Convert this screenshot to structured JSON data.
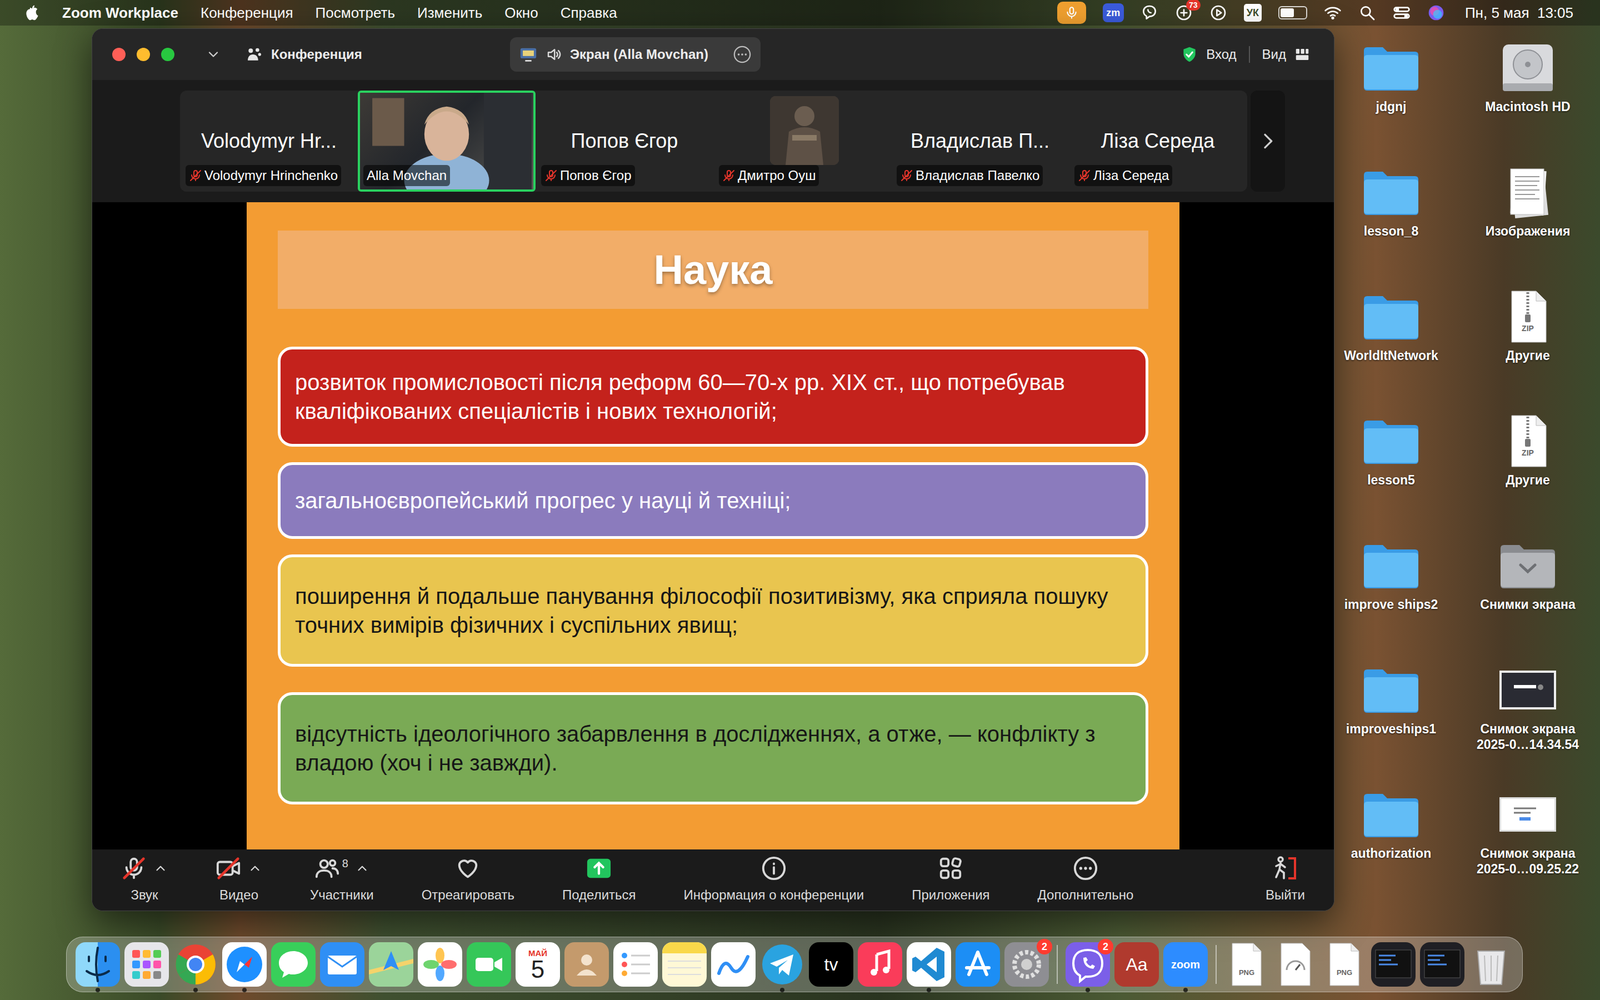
{
  "menu_bar": {
    "app": "Zoom Workplace",
    "menus": [
      "Конференция",
      "Посмотреть",
      "Изменить",
      "Окно",
      "Справка"
    ],
    "status": [
      {
        "kind": "mic"
      },
      {
        "kind": "zoom",
        "text": "zm"
      },
      {
        "kind": "viber"
      },
      {
        "kind": "app",
        "badge": "73"
      },
      {
        "kind": "play"
      },
      {
        "kind": "input",
        "text": "УК"
      },
      {
        "kind": "battery",
        "level": 0.55
      },
      {
        "kind": "wifi"
      },
      {
        "kind": "search"
      },
      {
        "kind": "control"
      },
      {
        "kind": "siri"
      }
    ],
    "clock": "Пн, 5 мая  13:05"
  },
  "window": {
    "title": "Конференция",
    "share": "Экран (Alla Movchan)",
    "signin": "Вход",
    "view": "Вид"
  },
  "participants": [
    {
      "kind": "name",
      "name": "Volodymyr Hr...",
      "label": "Volodymyr Hrinchenko",
      "muted": true,
      "selected": false
    },
    {
      "kind": "video",
      "label": "Alla Movchan",
      "muted": false,
      "selected": true
    },
    {
      "kind": "name",
      "name": "Попов Єгор",
      "label": "Попов Єгор",
      "muted": true,
      "selected": false
    },
    {
      "kind": "avatar",
      "label": "Дмитро Оуш",
      "muted": true,
      "selected": false
    },
    {
      "kind": "name",
      "name": "Владислав П...",
      "label": "Владислав Павелко",
      "muted": true,
      "selected": false
    },
    {
      "kind": "name",
      "name": "Ліза Середа",
      "label": "Ліза Середа",
      "muted": true,
      "selected": false
    }
  ],
  "slide": {
    "title": "Наука",
    "items": [
      {
        "text": "розвиток промисловості після реформ 60—70-х рр. XIX ст., що потребував кваліфікованих спеціалістів і нових технологій;",
        "color": "#c4221c"
      },
      {
        "text": "загальноєвропейський прогрес у науці й техніці;",
        "color": "#8b7bbd"
      },
      {
        "text": "поширення й подальше панування філософії позитивізму, яка сприяла пошуку точних вимірів фізичних і суспільних явищ;",
        "color": "#e9c54f"
      },
      {
        "text": "відсутність ідеологічного забарвлення в дослідженнях, а отже, — конфлікту з владою (хоч і не завжди).",
        "color": "#7aaa55"
      }
    ]
  },
  "toolbar": {
    "items": [
      {
        "kind": "audio",
        "label": "Звук",
        "off": true,
        "caret": true
      },
      {
        "kind": "video",
        "label": "Видео",
        "off": true,
        "caret": true
      },
      {
        "kind": "participants",
        "label": "Участники",
        "count": "8",
        "caret": true
      },
      {
        "kind": "react",
        "label": "Отреагировать",
        "caret": false
      },
      {
        "kind": "share",
        "label": "Поделиться",
        "caret": false
      },
      {
        "kind": "info",
        "label": "Информация о конференции",
        "caret": false
      },
      {
        "kind": "apps",
        "label": "Приложения",
        "caret": false
      },
      {
        "kind": "more",
        "label": "Дополнительно",
        "caret": false
      }
    ],
    "leave": "Выйти"
  },
  "desktop": [
    {
      "kind": "folder",
      "label": "jdgnj"
    },
    {
      "kind": "folder",
      "label": "lesson_8"
    },
    {
      "kind": "folder",
      "label": "WorldItNetwork"
    },
    {
      "kind": "folder",
      "label": "lesson5"
    },
    {
      "kind": "folder",
      "label": "improve ships2"
    },
    {
      "kind": "folder",
      "label": "improveships1"
    },
    {
      "kind": "folder",
      "label": "authorization"
    },
    {
      "kind": "disk",
      "label": "Macintosh HD"
    },
    {
      "kind": "document",
      "label": "Изображения"
    },
    {
      "kind": "zip",
      "label": "Другие",
      "text": "ZIP"
    },
    {
      "kind": "zip",
      "label": "Другие",
      "text": "ZIP"
    },
    {
      "kind": "screenshots",
      "label": "Снимки экрана"
    },
    {
      "kind": "shotdark",
      "label": "Снимок экрана 2025-0…14.34.54"
    },
    {
      "kind": "shotlight",
      "label": "Снимок экрана 2025-0…09.25.22"
    }
  ],
  "dock": [
    {
      "kind": "finder",
      "running": true
    },
    {
      "kind": "launchpad",
      "running": false
    },
    {
      "kind": "chrome",
      "running": true
    },
    {
      "kind": "safari",
      "running": true
    },
    {
      "kind": "messages",
      "running": false
    },
    {
      "kind": "mail",
      "running": false
    },
    {
      "kind": "maps",
      "running": false
    },
    {
      "kind": "photos",
      "running": false
    },
    {
      "kind": "facetime",
      "running": false
    },
    {
      "kind": "calendar",
      "month": "МАЙ",
      "day": "5",
      "running": false
    },
    {
      "kind": "contacts",
      "running": false
    },
    {
      "kind": "reminders",
      "running": false
    },
    {
      "kind": "notes",
      "running": false
    },
    {
      "kind": "freeform",
      "running": false
    },
    {
      "kind": "telegram",
      "running": true
    },
    {
      "kind": "tv",
      "text": "tv",
      "running": false
    },
    {
      "kind": "music",
      "running": false
    },
    {
      "kind": "vscode",
      "running": true
    },
    {
      "kind": "appstore",
      "running": false
    },
    {
      "kind": "settings",
      "badge": "2",
      "running": false
    },
    {
      "kind": "separator"
    },
    {
      "kind": "viber",
      "badge": "2",
      "running": true
    },
    {
      "kind": "dictionary",
      "text": "Aa",
      "running": false
    },
    {
      "kind": "zoom",
      "text": "zoom",
      "running": true
    },
    {
      "kind": "separator"
    },
    {
      "kind": "file",
      "text": "PNG",
      "running": false
    },
    {
      "kind": "gauge",
      "running": false
    },
    {
      "kind": "file",
      "text": "PNG",
      "running": false
    },
    {
      "kind": "shotfile",
      "running": false
    },
    {
      "kind": "shotfile",
      "running": false
    },
    {
      "kind": "trash",
      "running": false
    }
  ]
}
